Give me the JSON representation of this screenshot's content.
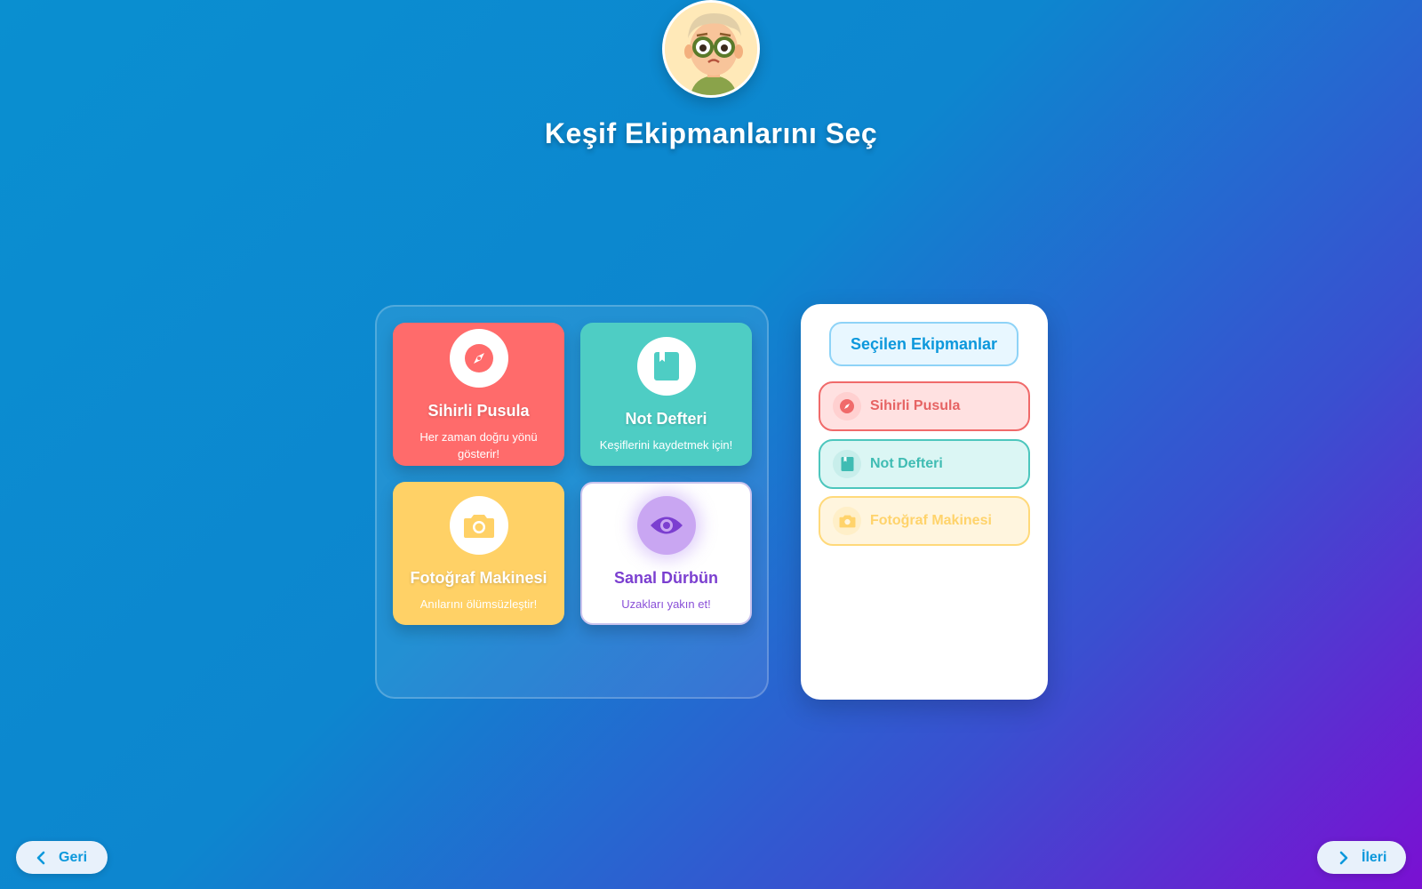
{
  "page": {
    "title": "Keşif Ekipmanlarını Seç"
  },
  "equipment": [
    {
      "id": "compass",
      "title": "Sihirli Pusula",
      "desc": "Her zaman doğru yönü gösterir!",
      "icon": "compass-icon",
      "color": "#ff6b6b"
    },
    {
      "id": "notebook",
      "title": "Not Defteri",
      "desc": "Keşiflerini kaydetmek için!",
      "icon": "notebook-icon",
      "color": "#4ecdc4"
    },
    {
      "id": "camera",
      "title": "Fotoğraf Makinesi",
      "desc": "Anılarını ölümsüzleştir!",
      "icon": "camera-icon",
      "color": "#ffd166"
    },
    {
      "id": "binoculars",
      "title": "Sanal Dürbün",
      "desc": "Uzakları yakın et!",
      "icon": "eye-icon",
      "color": "#7b3fd0"
    }
  ],
  "selected_panel": {
    "header": "Seçilen Ekipmanlar",
    "items": [
      {
        "label": "Sihirli Pusula",
        "icon": "compass-icon"
      },
      {
        "label": "Not Defteri",
        "icon": "notebook-icon"
      },
      {
        "label": "Fotoğraf Makinesi",
        "icon": "camera-icon"
      }
    ]
  },
  "nav": {
    "back_label": "Geri",
    "next_label": "İleri"
  }
}
